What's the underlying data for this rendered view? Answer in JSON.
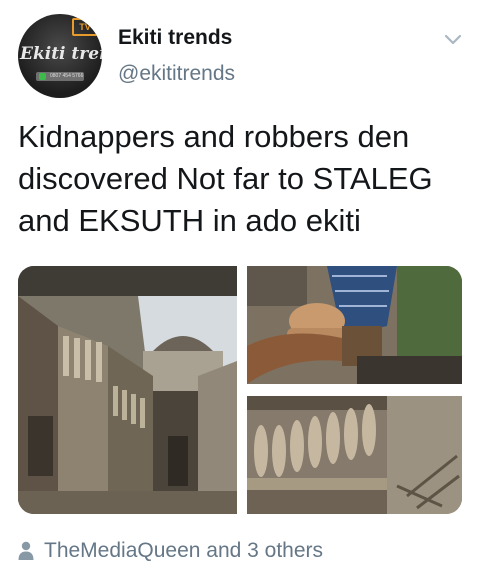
{
  "author": {
    "display_name": "Ekiti trends",
    "username": "@ekititrends",
    "avatar_logo_text": "Ekiti trends",
    "avatar_tv_text": "TV",
    "avatar_phone_text": "0807 454 5766"
  },
  "tweet": {
    "text": "Kidnappers and robbers den discovered Not far to STALEG and EKSUTH in ado ekiti"
  },
  "media": {
    "images": [
      {
        "description": "building-interior-corridors"
      },
      {
        "description": "person-showing-hands"
      },
      {
        "description": "balcony-balustrade-debris"
      }
    ]
  },
  "footer": {
    "likers_text": "TheMediaQueen and 3 others",
    "icon": "person-icon"
  },
  "colors": {
    "text": "#14171a",
    "secondary": "#657786",
    "avatar_accent": "#e89a2a"
  }
}
